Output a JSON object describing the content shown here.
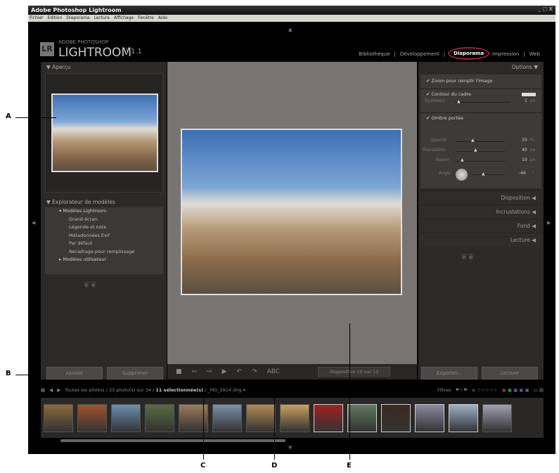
{
  "window": {
    "title": "Adobe Photoshop Lightroom",
    "controls": "_ □ X"
  },
  "menu": [
    "Fichier",
    "Edition",
    "Diaporama",
    "Lecture",
    "Affichage",
    "Fenêtre",
    "Aide"
  ],
  "logo": {
    "badge": "LR",
    "top": "ADOBE PHOTOSHOP",
    "main": "LIGHTROOM",
    "version": "1.1"
  },
  "modules": [
    {
      "label": "Bibliothèque"
    },
    {
      "label": "Développement"
    },
    {
      "label": "Diaporama",
      "selected": true
    },
    {
      "label": "Impression"
    },
    {
      "label": "Web"
    }
  ],
  "left": {
    "preview_title": "Aperçu",
    "explorer_title": "Explorateur de modèles",
    "tree": [
      {
        "label": "Modèles Lightroom"
      },
      {
        "label": "Grand écran"
      },
      {
        "label": "Légende et note"
      },
      {
        "label": "Métadonnées Exif"
      },
      {
        "label": "Par défaut"
      },
      {
        "label": "Recadrage pour remplissage"
      },
      {
        "label": "Modèles utilisateur"
      }
    ],
    "add": "Ajouter",
    "remove": "Supprimer"
  },
  "toolbar": {
    "text_tool": "ABC",
    "slide_counter": "Diapositive 10 sur 11"
  },
  "right": {
    "options_title": "Options",
    "zoom_fill": "Zoom pour remplir l'image",
    "stroke": "Contour du cadre",
    "thickness_label": "Epaisseur",
    "thickness": "1",
    "px": "px",
    "shadow": "Ombre portée",
    "opacity_label": "Opacité",
    "opacity": "33",
    "pct": "%",
    "offset_label": "Translation",
    "offset": "40",
    "radius_label": "Rayon",
    "radius": "10",
    "angle_label": "Angle",
    "angle": "-46",
    "deg": "°",
    "sections": [
      "Disposition",
      "Incrustations",
      "Fond",
      "Lecture"
    ],
    "export": "Exporter...",
    "play": "Lecture"
  },
  "filmstrip": {
    "path": "Toutes les photos / 33 photo(s) sur 34 / ",
    "selected": "11 sélectionnée(s)",
    "file": " / _MG_5914.dng",
    "filters": "Filtres",
    "thumb_count": 14
  },
  "annotations": [
    "A",
    "B",
    "C",
    "D",
    "E"
  ],
  "colors": {
    "accent": "#a2184e",
    "center_bg": "#787472"
  }
}
